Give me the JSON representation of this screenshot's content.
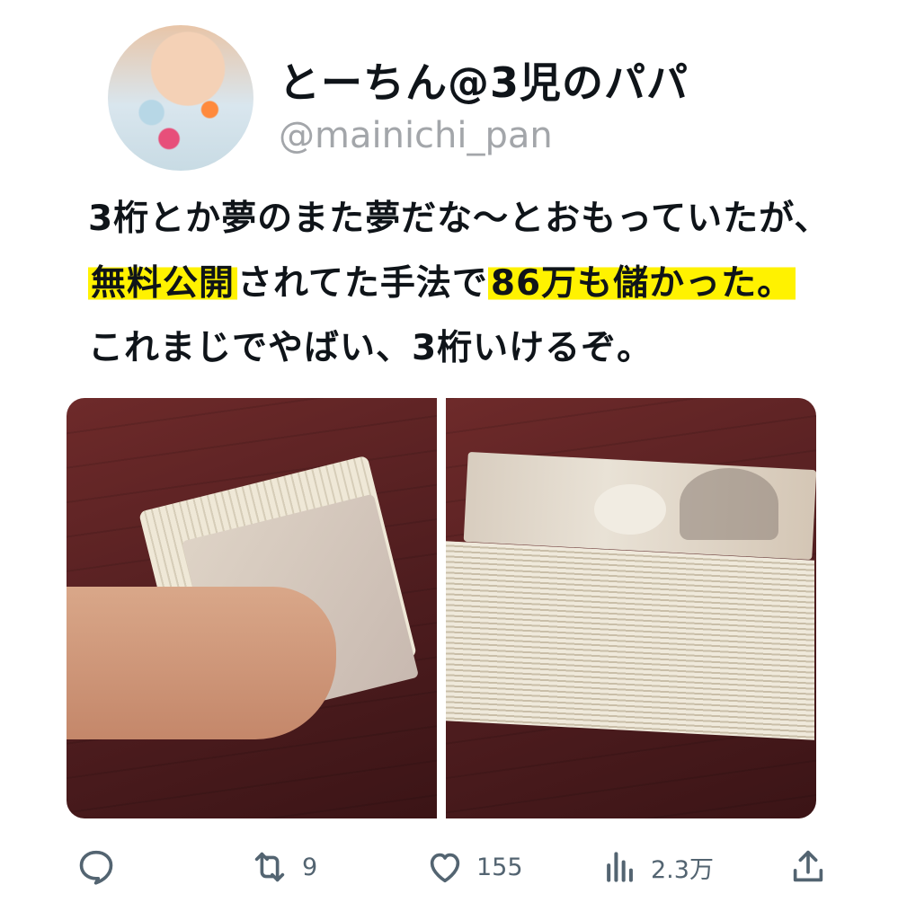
{
  "user": {
    "display_name": "とーちん@3児のパパ",
    "handle": "@mainichi_pan"
  },
  "tweet": {
    "line1": "3桁とか夢のまた夢だな〜とおもっていたが、",
    "line2_highlight1": "無料公開",
    "line2_mid": "されてた手法で",
    "line2_highlight2": "86万も儲かった。",
    "line3": "これまじでやばい、3桁いけるぞ。"
  },
  "media": [
    {
      "kind": "photo"
    },
    {
      "kind": "photo"
    }
  ],
  "actions": {
    "reply_icon": "reply-icon",
    "retweet_icon": "retweet-icon",
    "retweet_count": "9",
    "like_icon": "heart-icon",
    "like_count": "155",
    "views_icon": "views-icon",
    "views_count": "2.3万",
    "share_icon": "share-icon"
  },
  "colors": {
    "highlight": "#fff200",
    "muted": "#536471",
    "handle": "#a3a6aa"
  }
}
